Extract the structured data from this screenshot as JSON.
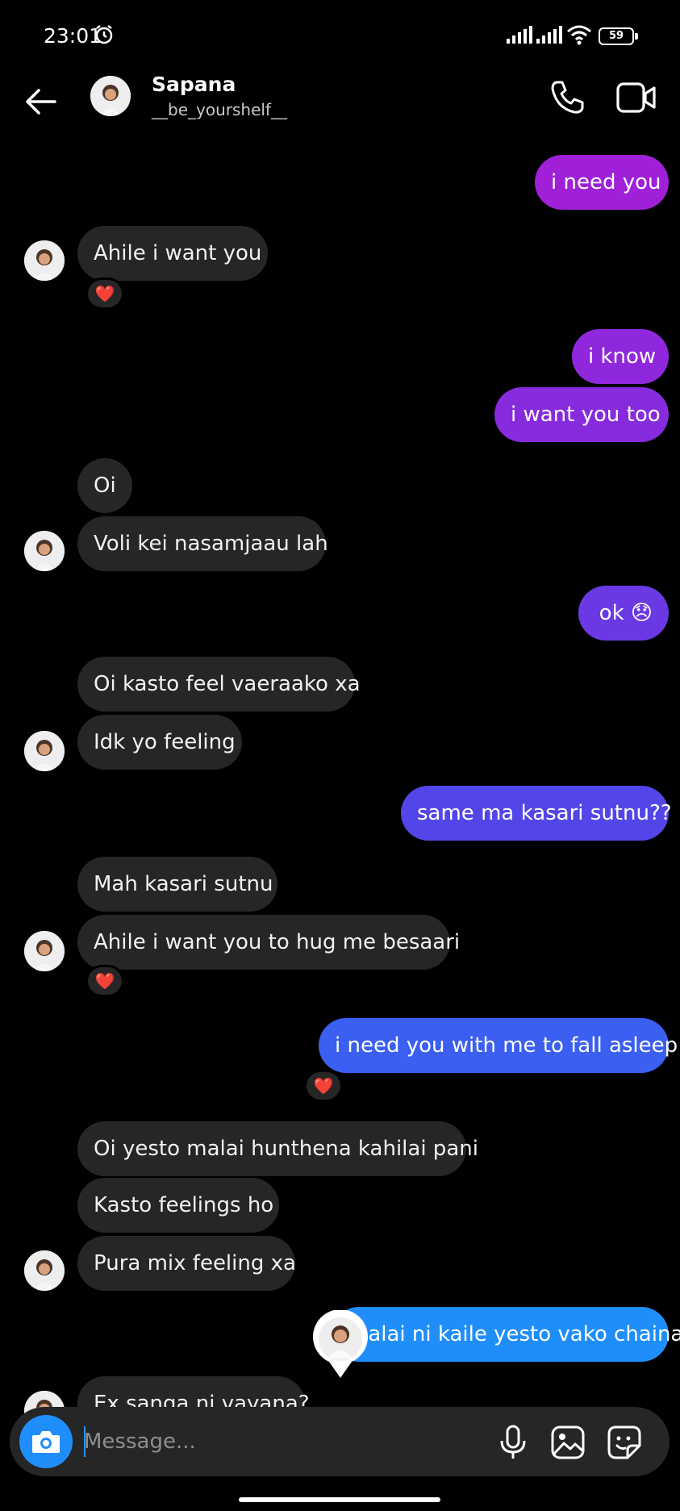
{
  "status_bar": {
    "time": "23:01",
    "battery": "59"
  },
  "header": {
    "name": "Sapana",
    "username": "__be_yourshelf__"
  },
  "messages": [
    {
      "dir": "out",
      "text": "i need you"
    },
    {
      "dir": "in",
      "text": "Ahile i want you",
      "reaction": "❤️"
    },
    {
      "dir": "out",
      "text": "i know"
    },
    {
      "dir": "out",
      "text": "i want you too"
    },
    {
      "dir": "in",
      "text": "Oi"
    },
    {
      "dir": "in",
      "text": "Voli kei nasamjaau lah"
    },
    {
      "dir": "out",
      "text": "ok 😞"
    },
    {
      "dir": "in",
      "text": "Oi kasto feel vaeraako xa"
    },
    {
      "dir": "in",
      "text": "Idk yo feeling"
    },
    {
      "dir": "out",
      "text": "same ma kasari sutnu??"
    },
    {
      "dir": "in",
      "text": "Mah kasari sutnu"
    },
    {
      "dir": "in",
      "text": "Ahile i want you to hug me besaari",
      "reaction": "❤️"
    },
    {
      "dir": "out",
      "text": "i need you with me to fall asleep",
      "reaction": "❤️"
    },
    {
      "dir": "in",
      "text": "Oi yesto malai hunthena kahilai pani"
    },
    {
      "dir": "in",
      "text": "Kasto feelings ho"
    },
    {
      "dir": "in",
      "text": "Pura mix feeling xa"
    },
    {
      "dir": "out",
      "text": "malai ni kaile yesto vako chaina"
    },
    {
      "dir": "in",
      "text": "Ex sanga ni vayana?"
    }
  ],
  "composer": {
    "placeholder": "Message..."
  },
  "colors": {
    "out_gradient": [
      "#a020d8",
      "#7d2fe0",
      "#5a44e8",
      "#3d5cf0",
      "#1f8efa"
    ],
    "incoming": "#262626",
    "accent": "#1f8efa"
  },
  "icons": [
    "arrow-left-icon",
    "phone-icon",
    "video-camera-icon",
    "camera-icon",
    "microphone-icon",
    "gallery-icon",
    "sticker-icon",
    "heart-icon"
  ]
}
